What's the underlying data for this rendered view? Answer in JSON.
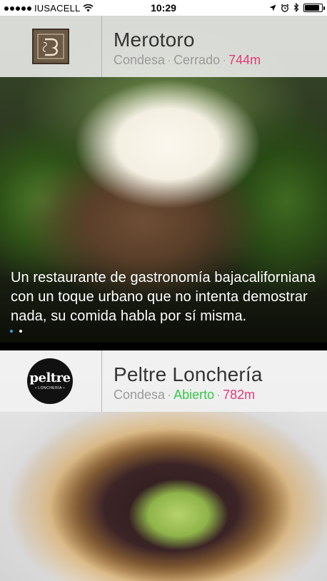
{
  "status_bar": {
    "carrier": "IUSACELL",
    "time": "10:29",
    "battery_level": 0.85,
    "icons": [
      "signal-dots-icon",
      "wifi-icon",
      "location-arrow-icon",
      "alarm-icon",
      "bluetooth-icon",
      "battery-icon"
    ]
  },
  "restaurants": [
    {
      "name": "Merotoro",
      "neighborhood": "Condesa",
      "status": "Cerrado",
      "distance": "744m",
      "description": "Un restaurante de gastronomía bajacaliforniana con un toque urbano que no intenta demostrar nada, su comida habla por sí misma.",
      "pager_count": 2,
      "pager_active": 0
    },
    {
      "name": "Peltre Lonchería",
      "neighborhood": "Condesa",
      "status": "Abierto",
      "distance": "782m",
      "logo_word": "peltre",
      "logo_sub": "• LONCHERÍA •"
    }
  ],
  "separator": "·",
  "colors": {
    "distance": "#e23a7a",
    "open": "#37c84a",
    "pager_active": "#2fa8e6"
  }
}
